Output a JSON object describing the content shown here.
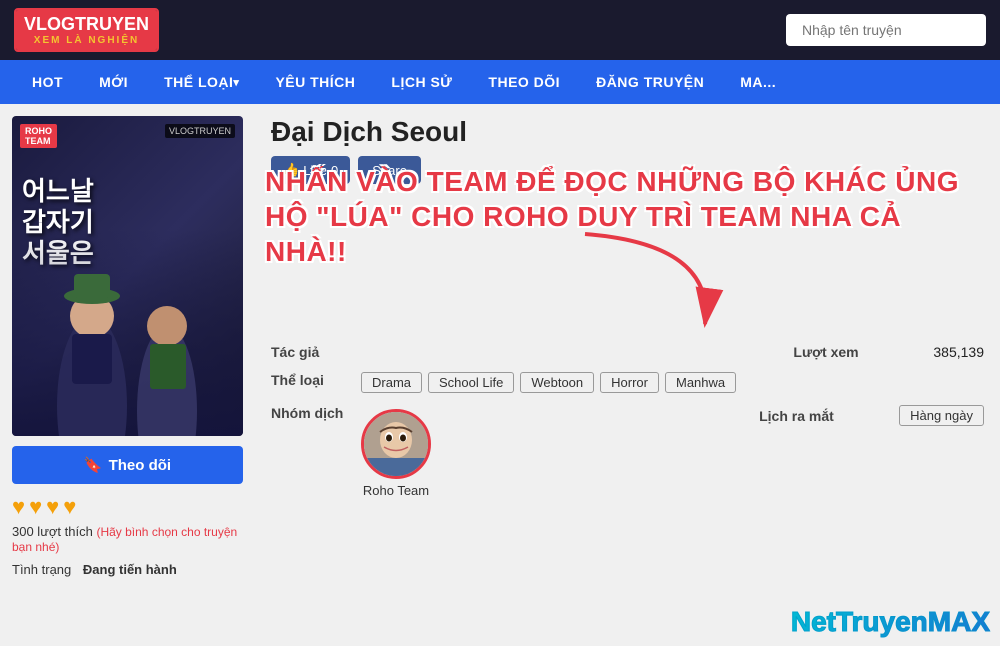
{
  "header": {
    "logo_main": "VLOGTRUYEN",
    "logo_sub": "XEM LÀ NGHIỆN",
    "search_placeholder": "Nhập tên truyện"
  },
  "nav": {
    "items": [
      {
        "label": "HOT",
        "has_arrow": false
      },
      {
        "label": "MỚI",
        "has_arrow": false
      },
      {
        "label": "THỂ LOẠI",
        "has_arrow": true
      },
      {
        "label": "YÊU THÍCH",
        "has_arrow": false
      },
      {
        "label": "LỊCH SỬ",
        "has_arrow": false
      },
      {
        "label": "THEO DÕI",
        "has_arrow": false
      },
      {
        "label": "ĐĂNG TRUYỆN",
        "has_arrow": false
      },
      {
        "label": "MA...",
        "has_arrow": false
      }
    ]
  },
  "manga": {
    "title": "Đại Dịch Seoul",
    "cover": {
      "team_label": "ROHO\nTEAM",
      "site_label": "VLOGTRUYEN",
      "title_kr": "어느날\n갑자기\n서울은"
    },
    "like_count": "0",
    "like_label": "Like",
    "share_label": "Share",
    "promo_text": "NHẤN VÀO TEAM ĐỂ ĐỌC NHỮNG BỘ KHÁC ỦNG HỘ \"LÚA\" CHO ROHO DUY TRÌ TEAM NHA CẢ NHÀ!!",
    "tac_gia_label": "Tác giả",
    "tac_gia_value": "",
    "luot_xem_label": "Lượt xem",
    "luot_xem_value": "385,139",
    "the_loai_label": "Thể loại",
    "genres": [
      "Drama",
      "School Life",
      "Webtoon",
      "Horror",
      "Manhwa"
    ],
    "nhom_dich_label": "Nhóm dịch",
    "team_name": "Roho Team",
    "lich_ra_mat_label": "Lịch ra mắt",
    "lich_ra_mat_value": "Hàng ngày",
    "follow_label": "Theo dõi",
    "hearts": [
      "♥",
      "♥",
      "♥",
      "♥"
    ],
    "vote_count": "300 lượt thích",
    "vote_hint": "(Hãy bình chọn cho truyện bạn nhé)",
    "tinh_trang_label": "Tình trạng",
    "tinh_trang_value": "Đang tiến hành"
  },
  "watermark": "NetTruyenMAX"
}
